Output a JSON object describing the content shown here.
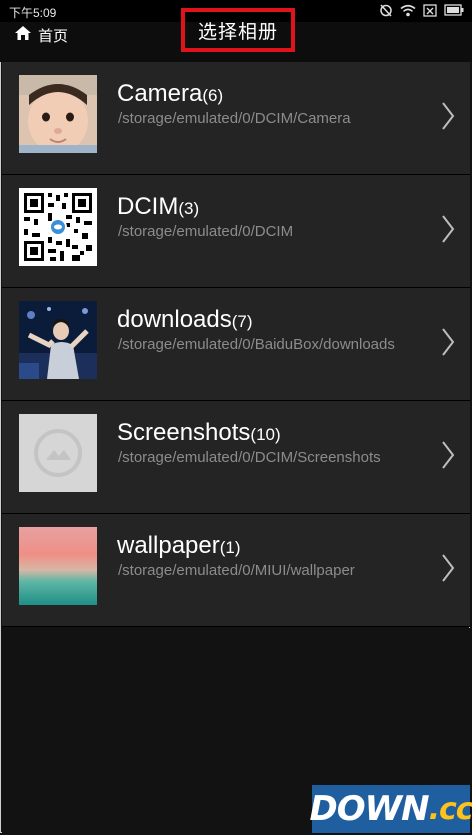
{
  "status": {
    "time": "下午5:09"
  },
  "header": {
    "back_label": "首页",
    "title": "选择相册"
  },
  "albums": [
    {
      "name": "Camera",
      "count": "(6)",
      "path": "/storage/emulated/0/DCIM/Camera",
      "thumb": "baby-photo"
    },
    {
      "name": "DCIM",
      "count": "(3)",
      "path": "/storage/emulated/0/DCIM",
      "thumb": "qr-code"
    },
    {
      "name": "downloads",
      "count": "(7)",
      "path": "/storage/emulated/0/BaiduBox/downloads",
      "thumb": "concert-photo"
    },
    {
      "name": "Screenshots",
      "count": "(10)",
      "path": "/storage/emulated/0/DCIM/Screenshots",
      "thumb": "image-placeholder"
    },
    {
      "name": "wallpaper",
      "count": "(1)",
      "path": "/storage/emulated/0/MIUI/wallpaper",
      "thumb": "gradient-landscape"
    }
  ],
  "watermark": {
    "main": "DOWN",
    "suffix": ".cc"
  },
  "icons": [
    "home-icon",
    "chevron-right-icon",
    "alarm-icon",
    "wifi-icon",
    "battery-icon"
  ]
}
